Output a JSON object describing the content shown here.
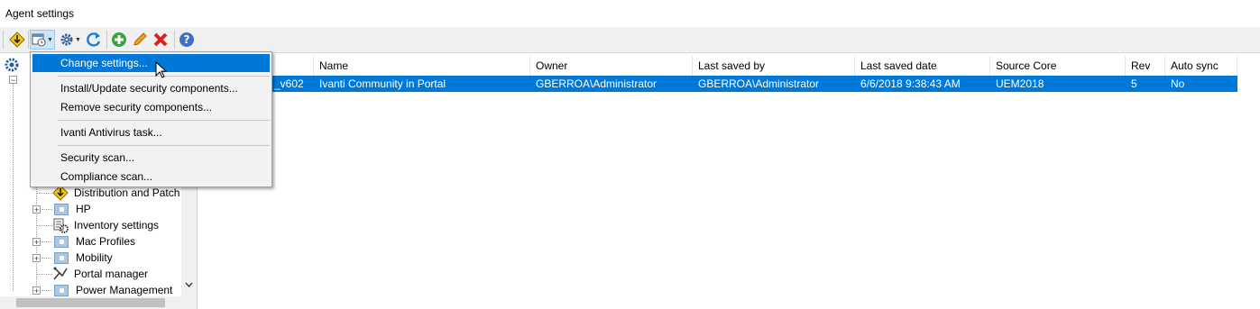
{
  "window": {
    "title": "Agent settings"
  },
  "toolbar": {
    "buttons": [
      {
        "icon": "download-warning-icon"
      },
      {
        "icon": "schedule-task-icon",
        "dropdown": true
      },
      {
        "icon": "gear-icon",
        "dropdown": true
      },
      {
        "icon": "refresh-icon"
      },
      {
        "icon": "add-icon"
      },
      {
        "icon": "edit-icon"
      },
      {
        "icon": "delete-icon"
      },
      {
        "icon": "help-icon"
      }
    ]
  },
  "context_menu": {
    "items": [
      {
        "label": "Change settings...",
        "selected": true
      },
      {
        "label": "Install/Update security components..."
      },
      {
        "label": "Remove security components..."
      },
      {
        "label": "Ivanti Antivirus task..."
      },
      {
        "label": "Security scan..."
      },
      {
        "label": "Compliance scan..."
      }
    ]
  },
  "tree": {
    "items": [
      {
        "label": "Distribution and Patch",
        "icon": "distribution-patch-icon"
      },
      {
        "label": "HP",
        "icon": "folder-icon",
        "expandable": true
      },
      {
        "label": "Inventory settings",
        "icon": "inventory-icon"
      },
      {
        "label": "Mac Profiles",
        "icon": "folder-icon",
        "expandable": true
      },
      {
        "label": "Mobility",
        "icon": "folder-icon",
        "expandable": true
      },
      {
        "label": "Portal manager",
        "icon": "portal-manager-icon"
      },
      {
        "label": "Power Management",
        "icon": "folder-icon",
        "expandable": true
      }
    ]
  },
  "grid": {
    "columns": [
      "Name",
      "Owner",
      "Last saved by",
      "Last saved date",
      "Source Core",
      "Rev",
      "Auto sync"
    ],
    "rows": [
      {
        "id": "_v602",
        "name": "Ivanti Community in Portal",
        "owner": "GBERROA\\Administrator",
        "last_saved_by": "GBERROA\\Administrator",
        "last_saved_date": "6/6/2018 9:38:43 AM",
        "source_core": "UEM2018",
        "rev": "5",
        "auto_sync": "No"
      }
    ]
  },
  "colors": {
    "selection": "#0078d7",
    "toolbar_bg": "#f0f0f0"
  }
}
